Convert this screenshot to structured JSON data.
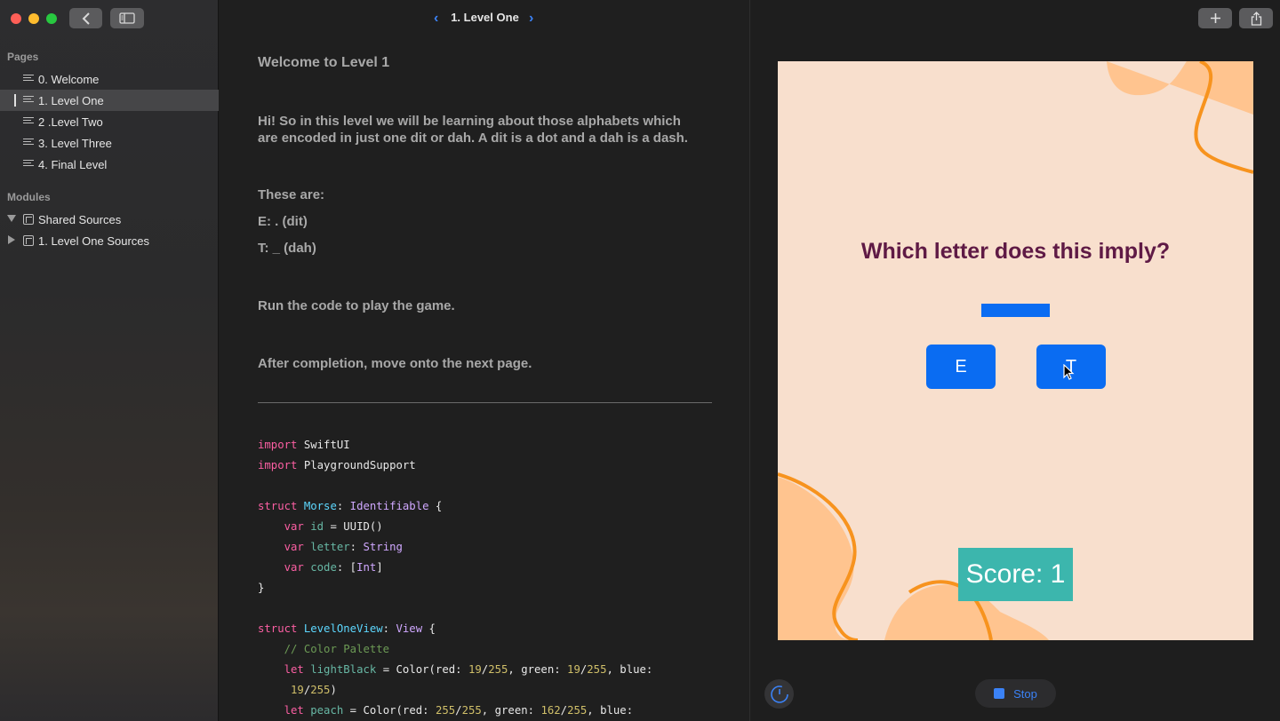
{
  "sidebar": {
    "pages_label": "Pages",
    "pages": [
      {
        "label": "0. Welcome"
      },
      {
        "label": "1. Level One"
      },
      {
        "label": "2 .Level Two"
      },
      {
        "label": "3. Level Three"
      },
      {
        "label": "4. Final Level"
      }
    ],
    "selected_page": "1. Level One",
    "modules_label": "Modules",
    "modules": [
      {
        "label": "Shared Sources",
        "expanded": true
      },
      {
        "label": "1. Level One Sources",
        "expanded": false
      }
    ]
  },
  "toolbar": {
    "title": "1. Level One",
    "back_icon": "chevron-left-icon",
    "sidebar_icon": "sidebar-toggle-icon",
    "add_icon": "plus-icon",
    "share_icon": "share-icon"
  },
  "prose": {
    "heading": "Welcome to Level 1",
    "intro_line1": "Hi! So in this level we will be learning about those alphabets which",
    "intro_line2": "are encoded in just one dit or dah. A dit is a dot and a dah is a dash.",
    "these_are": "These are:",
    "e_line": "E: . (dit)",
    "t_line": "T: _ (dah)",
    "run": "Run the code to play the game.",
    "after": "After completion, move onto the next page."
  },
  "code": {
    "line1": [
      "import",
      "SwiftUI"
    ],
    "line2": [
      "import",
      "PlaygroundSupport"
    ],
    "line4": [
      "struct",
      "Morse",
      "Identifiable"
    ],
    "line5": [
      "var",
      "id",
      "UUID()"
    ],
    "line6": [
      "var",
      "letter",
      "String"
    ],
    "line7": [
      "var",
      "code",
      "Int"
    ],
    "line10": [
      "struct",
      "LevelOneView",
      "View"
    ],
    "line11": "// Color Palette",
    "line12": [
      "let",
      "lightBlack",
      "Color(red:",
      "19",
      "255",
      "green:",
      "19",
      "255",
      "blue:"
    ],
    "line13": [
      "19",
      "255"
    ],
    "line14": [
      "let",
      "peach",
      "Color(red:",
      "255",
      "255",
      "green:",
      "162",
      "255",
      "blue:"
    ]
  },
  "live_view": {
    "question": "Which letter does this imply?",
    "answer_e": "E",
    "answer_t": "T",
    "score": "Score: 1",
    "colors": {
      "background": "#f8dfcd",
      "button": "#0a6cf2",
      "score": "#3cb6ad",
      "question": "#5f1a45",
      "blob": "#ffc48f",
      "blob_stroke": "#f7931e"
    }
  },
  "controls": {
    "stop_label": "Stop",
    "speed_icon": "speed-gauge-icon"
  }
}
